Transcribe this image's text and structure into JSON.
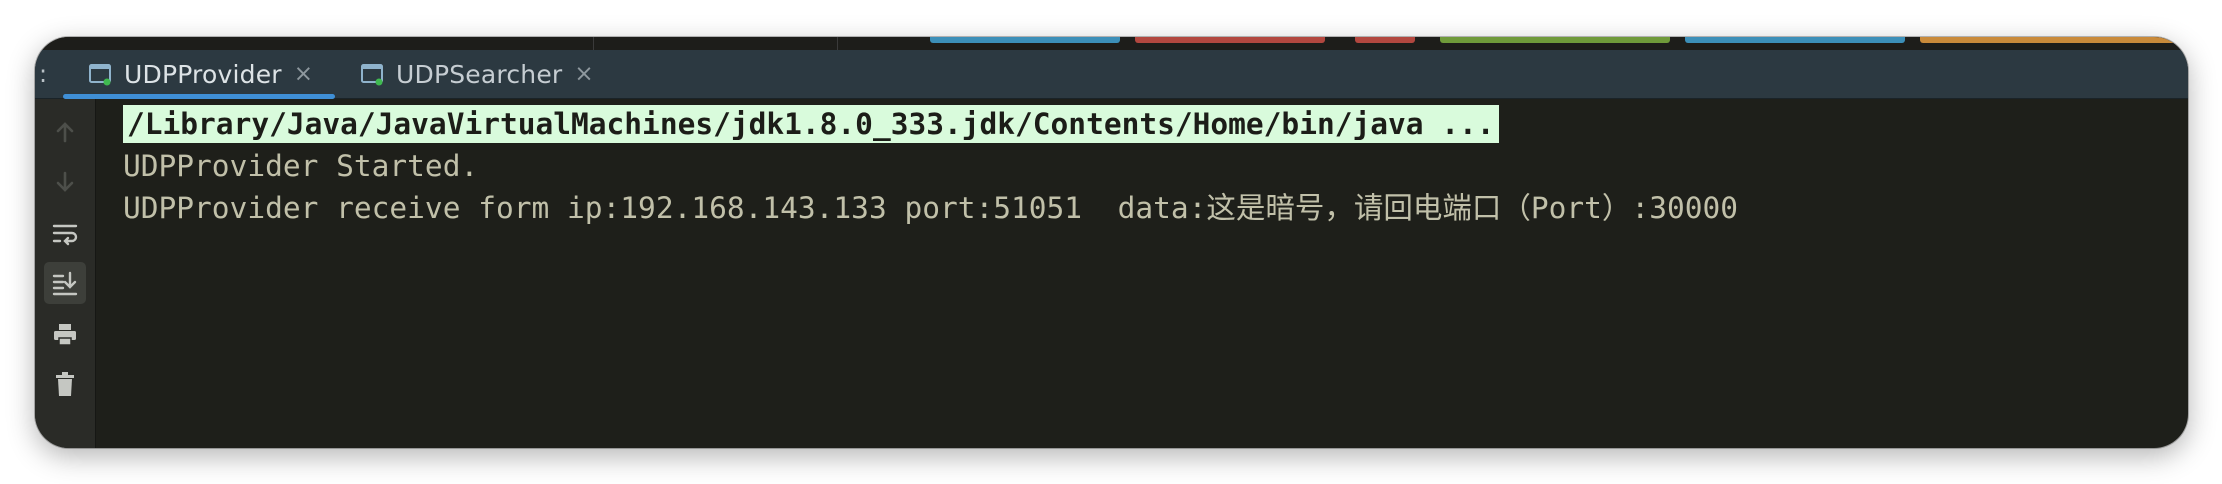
{
  "tool_window": {
    "label_fragment": ":"
  },
  "tabs": [
    {
      "label": "UDPProvider",
      "active": true,
      "icon": "console-run-icon",
      "close": "×"
    },
    {
      "label": "UDPSearcher",
      "active": false,
      "icon": "console-run-icon",
      "close": "×"
    }
  ],
  "console": {
    "command": "/Library/Java/JavaVirtualMachines/jdk1.8.0_333.jdk/Contents/Home/bin/java ...",
    "lines": [
      "UDPProvider Started.",
      "UDPProvider receive form ip:192.168.143.133 port:51051  data:这是暗号，请回电端口（Port）:30000"
    ]
  },
  "toolbar": [
    {
      "name": "up-arrow-icon",
      "enabled": false
    },
    {
      "name": "down-arrow-icon",
      "enabled": false
    },
    {
      "name": "soft-wrap-icon",
      "enabled": true
    },
    {
      "name": "scroll-to-end-icon",
      "enabled": true,
      "selected": true
    },
    {
      "name": "print-icon",
      "enabled": true
    },
    {
      "name": "trash-icon",
      "enabled": true
    }
  ],
  "colors": {
    "console_bg": "#1e1f1a",
    "tab_bar_bg": "#2c3941",
    "text": "#c1c0a9",
    "command_highlight": "#d9fbdc",
    "active_tab_underline": "#3f8fd6"
  }
}
